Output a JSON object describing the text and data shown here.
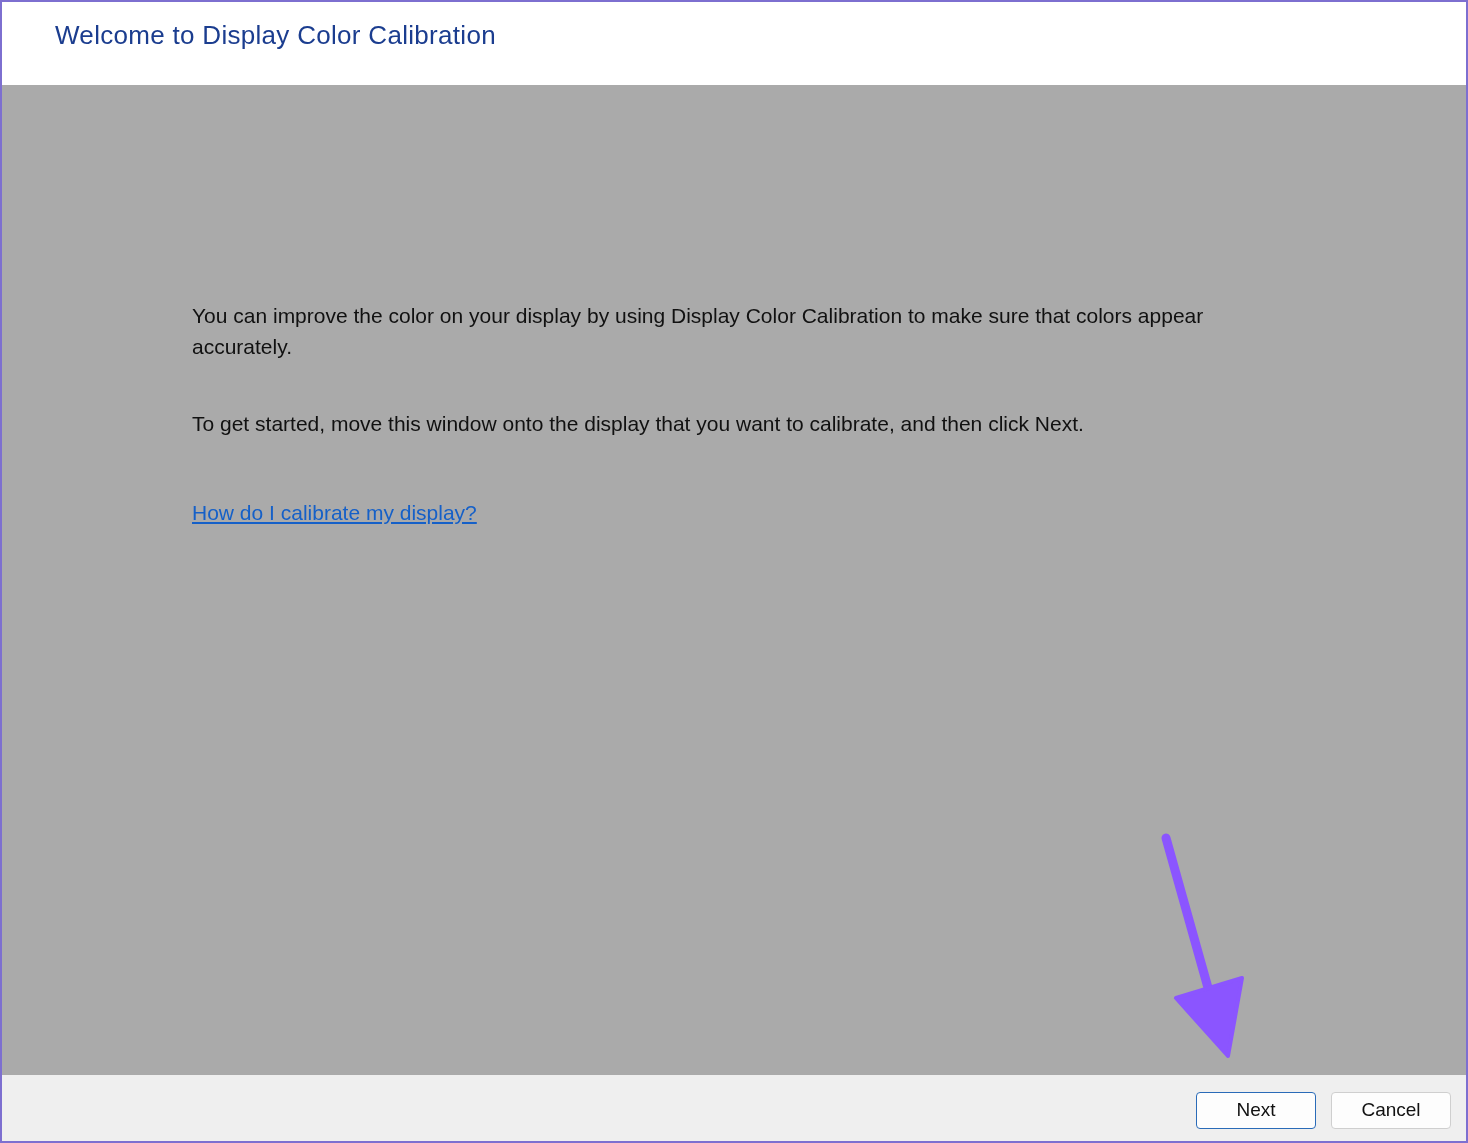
{
  "window": {
    "title": "Welcome to Display Color Calibration"
  },
  "body": {
    "paragraphs": [
      "You can improve the color on your display by using Display Color Calibration to make sure that colors appear accurately.",
      "To get started, move this window onto the display that you want to calibrate, and then click Next."
    ],
    "link": "How do I calibrate my display?"
  },
  "buttons": [
    {
      "label": "Next",
      "default": true
    },
    {
      "label": "Cancel",
      "default": false
    }
  ]
}
